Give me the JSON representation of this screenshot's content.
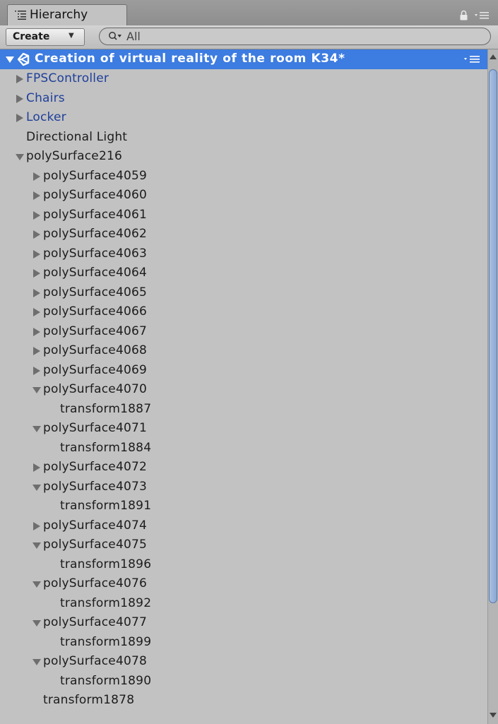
{
  "panel": {
    "tab_title": "Hierarchy",
    "tab_icon": "hierarchy-list-icon",
    "lock_icon": "lock-icon",
    "menu_icon": "panel-menu-icon"
  },
  "toolbar": {
    "create_label": "Create",
    "search_value": "All",
    "search_placeholder": "All"
  },
  "scene": {
    "title": "Creation of virtual reality of the room K34*",
    "icon": "unity-logo-icon",
    "expanded": true
  },
  "colors": {
    "selection": "#3d7ce0",
    "prefab_text": "#1f3f9a",
    "panel_bg": "#c2c2c2"
  },
  "tree": [
    {
      "label": "FPSController",
      "depth": 1,
      "arrow": "collapsed",
      "prefab": true
    },
    {
      "label": "Chairs",
      "depth": 1,
      "arrow": "collapsed",
      "prefab": true
    },
    {
      "label": "Locker",
      "depth": 1,
      "arrow": "collapsed",
      "prefab": true
    },
    {
      "label": "Directional Light",
      "depth": 1,
      "arrow": "none",
      "prefab": false
    },
    {
      "label": "polySurface216",
      "depth": 1,
      "arrow": "expanded",
      "prefab": false
    },
    {
      "label": "polySurface4059",
      "depth": 2,
      "arrow": "collapsed",
      "prefab": false
    },
    {
      "label": "polySurface4060",
      "depth": 2,
      "arrow": "collapsed",
      "prefab": false
    },
    {
      "label": "polySurface4061",
      "depth": 2,
      "arrow": "collapsed",
      "prefab": false
    },
    {
      "label": "polySurface4062",
      "depth": 2,
      "arrow": "collapsed",
      "prefab": false
    },
    {
      "label": "polySurface4063",
      "depth": 2,
      "arrow": "collapsed",
      "prefab": false
    },
    {
      "label": "polySurface4064",
      "depth": 2,
      "arrow": "collapsed",
      "prefab": false
    },
    {
      "label": "polySurface4065",
      "depth": 2,
      "arrow": "collapsed",
      "prefab": false
    },
    {
      "label": "polySurface4066",
      "depth": 2,
      "arrow": "collapsed",
      "prefab": false
    },
    {
      "label": "polySurface4067",
      "depth": 2,
      "arrow": "collapsed",
      "prefab": false
    },
    {
      "label": "polySurface4068",
      "depth": 2,
      "arrow": "collapsed",
      "prefab": false
    },
    {
      "label": "polySurface4069",
      "depth": 2,
      "arrow": "collapsed",
      "prefab": false
    },
    {
      "label": "polySurface4070",
      "depth": 2,
      "arrow": "expanded",
      "prefab": false
    },
    {
      "label": "transform1887",
      "depth": 3,
      "arrow": "none",
      "prefab": false
    },
    {
      "label": "polySurface4071",
      "depth": 2,
      "arrow": "expanded",
      "prefab": false
    },
    {
      "label": "transform1884",
      "depth": 3,
      "arrow": "none",
      "prefab": false
    },
    {
      "label": "polySurface4072",
      "depth": 2,
      "arrow": "collapsed",
      "prefab": false
    },
    {
      "label": "polySurface4073",
      "depth": 2,
      "arrow": "expanded",
      "prefab": false
    },
    {
      "label": "transform1891",
      "depth": 3,
      "arrow": "none",
      "prefab": false
    },
    {
      "label": "polySurface4074",
      "depth": 2,
      "arrow": "collapsed",
      "prefab": false
    },
    {
      "label": "polySurface4075",
      "depth": 2,
      "arrow": "expanded",
      "prefab": false
    },
    {
      "label": "transform1896",
      "depth": 3,
      "arrow": "none",
      "prefab": false
    },
    {
      "label": "polySurface4076",
      "depth": 2,
      "arrow": "expanded",
      "prefab": false
    },
    {
      "label": "transform1892",
      "depth": 3,
      "arrow": "none",
      "prefab": false
    },
    {
      "label": "polySurface4077",
      "depth": 2,
      "arrow": "expanded",
      "prefab": false
    },
    {
      "label": "transform1899",
      "depth": 3,
      "arrow": "none",
      "prefab": false
    },
    {
      "label": "polySurface4078",
      "depth": 2,
      "arrow": "expanded",
      "prefab": false
    },
    {
      "label": "transform1890",
      "depth": 3,
      "arrow": "none",
      "prefab": false
    },
    {
      "label": "transform1878",
      "depth": 2,
      "arrow": "none",
      "prefab": false
    }
  ],
  "scrollbar": {
    "up_icon": "scroll-up-arrow-icon",
    "down_icon": "scroll-down-arrow-icon"
  }
}
